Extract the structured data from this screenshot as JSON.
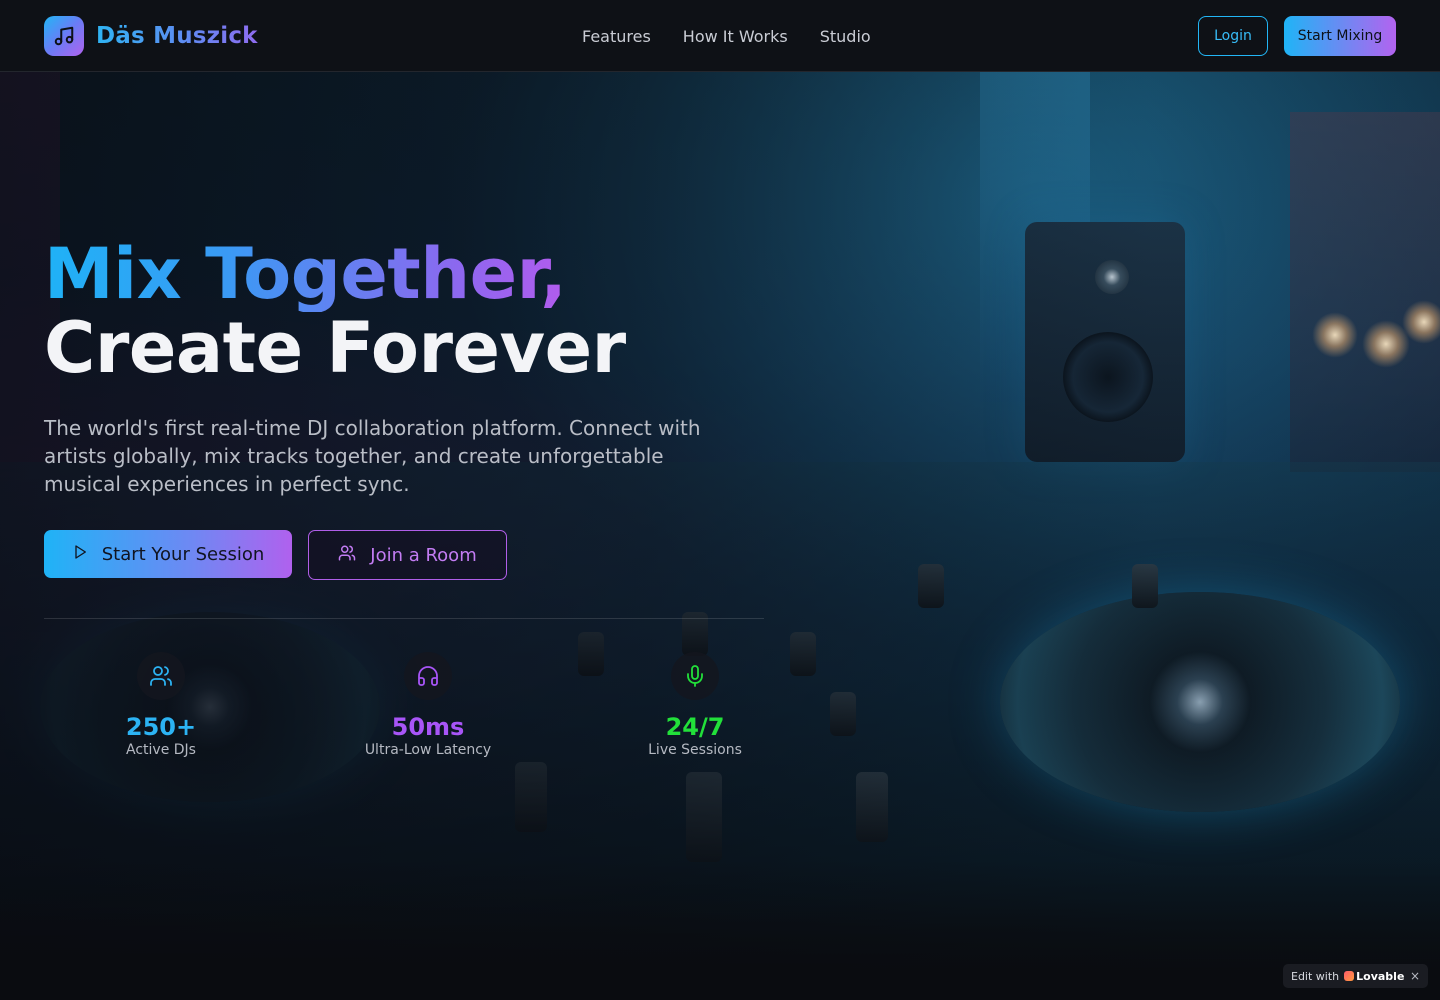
{
  "brand": {
    "name": "Däs Muszick",
    "logo_icon": "music-note-icon"
  },
  "nav": {
    "links": [
      "Features",
      "How It Works",
      "Studio"
    ],
    "login_label": "Login",
    "start_label": "Start Mixing"
  },
  "hero": {
    "headline_line1": "Mix Together,",
    "headline_line2": "Create Forever",
    "description": "The world's first real-time DJ collaboration platform. Connect with artists globally, mix tracks together, and create unforgettable musical experiences in perfect sync.",
    "primary_cta": {
      "label": "Start Your Session",
      "icon": "play-icon"
    },
    "secondary_cta": {
      "label": "Join a Room",
      "icon": "users-icon"
    }
  },
  "stats": [
    {
      "value": "250+",
      "label": "Active DJs",
      "icon": "users-icon",
      "color": "#2cb3f3"
    },
    {
      "value": "50ms",
      "label": "Ultra-Low Latency",
      "icon": "headphones-icon",
      "color": "#a855f7"
    },
    {
      "value": "24/7",
      "label": "Live Sessions",
      "icon": "microphone-icon",
      "color": "#22e03a"
    }
  ],
  "badge": {
    "prefix": "Edit with",
    "brand": "Lovable",
    "close": "×"
  },
  "colors": {
    "accent_blue": "#1fb3f6",
    "accent_purple": "#b061ee",
    "accent_green": "#22e03a"
  }
}
